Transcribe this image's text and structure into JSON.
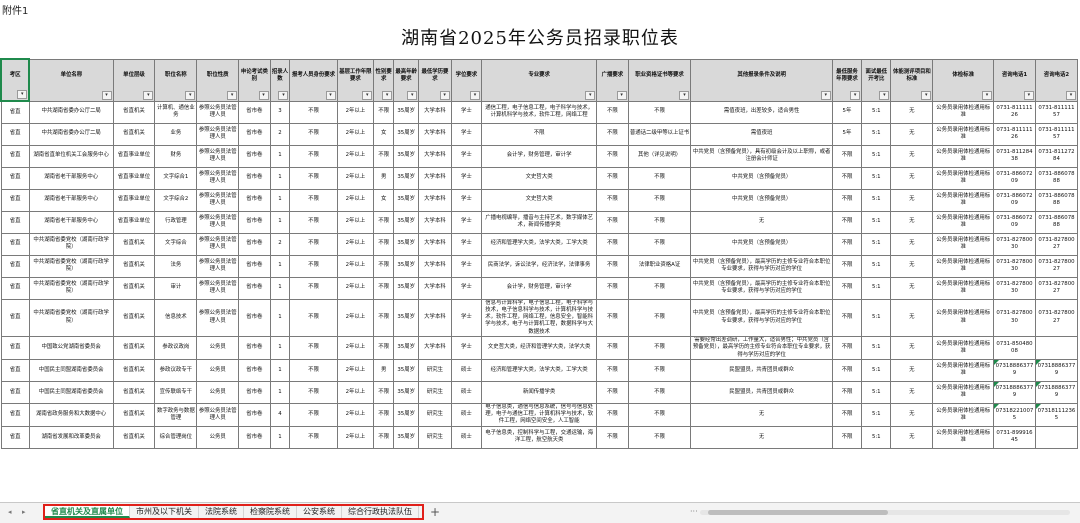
{
  "attachment_label": "附件1",
  "title": "湖南省2025年公务员招录职位表",
  "filter_icon": "▾",
  "headers": [
    "考区",
    "单位名称",
    "单位层级",
    "职位名称",
    "职位性质",
    "申论考试类别",
    "招录人数",
    "报考人员身份要求",
    "基层工作年限要求",
    "性别要求",
    "最高年龄要求",
    "最低学历要求",
    "学位要求",
    "专业要求",
    "广播要求",
    "职业资格证书等要求",
    "其他报录条件及说明",
    "最低服务年限要求",
    "面试最低开考比",
    "体能测评项目和标准",
    "体检标准",
    "咨询电话1",
    "咨询电话2"
  ],
  "rows": [
    [
      "省直",
      "中共湖南省委办公厅二局",
      "省直机关",
      "计算机、通信业务",
      "参照公务员法管理人员",
      "省市卷",
      "3",
      "不限",
      "2年以上",
      "不限",
      "35周岁",
      "大学本科",
      "学士",
      "通信工程，电子信息工程，电子科学与技术，计算机科学与技术，软件工程，网络工程",
      "不限",
      "不限",
      "需值夜班，出差较多，适合男性",
      "5年",
      "5:1",
      "无",
      "公务员录用体检通用标准",
      "0731-81111126",
      "0731-81111157"
    ],
    [
      "省直",
      "中共湖南省委办公厅二局",
      "省直机关",
      "业务",
      "参照公务员法管理人员",
      "省市卷",
      "2",
      "不限",
      "2年以上",
      "女",
      "35周岁",
      "大学本科",
      "学士",
      "不限",
      "不限",
      "普通话二级甲等以上证书",
      "需值夜班",
      "5年",
      "5:1",
      "无",
      "公务员录用体检通用标准",
      "0731-81111126",
      "0731-81111157"
    ],
    [
      "省直",
      "湖南省直单位机关工会服务中心",
      "省直事业单位",
      "财务",
      "参照公务员法管理人员",
      "省市卷",
      "1",
      "不限",
      "2年以上",
      "不限",
      "35周岁",
      "大学本科",
      "学士",
      "会计学，财务管理，审计学",
      "不限",
      "其他（详见说明）",
      "中共党员（含预备党员），具有初级会计及以上职称，或者注册会计师证",
      "不限",
      "5:1",
      "无",
      "公务员录用体检通用标准",
      "0731-81128438",
      "0731-81127284"
    ],
    [
      "省直",
      "湖南省老干部服务中心",
      "省直事业单位",
      "文字综合1",
      "参照公务员法管理人员",
      "省市卷",
      "1",
      "不限",
      "2年以上",
      "男",
      "35周岁",
      "大学本科",
      "学士",
      "文史哲大类",
      "不限",
      "不限",
      "中共党员（含预备党员）",
      "不限",
      "5:1",
      "无",
      "公务员录用体检通用标准",
      "0731-88607209",
      "0731-88607888"
    ],
    [
      "省直",
      "湖南省老干部服务中心",
      "省直事业单位",
      "文字综合2",
      "参照公务员法管理人员",
      "省市卷",
      "1",
      "不限",
      "2年以上",
      "女",
      "35周岁",
      "大学本科",
      "学士",
      "文史哲大类",
      "不限",
      "不限",
      "中共党员（含预备党员）",
      "不限",
      "5:1",
      "无",
      "公务员录用体检通用标准",
      "0731-88607209",
      "0731-88607888"
    ],
    [
      "省直",
      "湖南省老干部服务中心",
      "省直事业单位",
      "行政管理",
      "参照公务员法管理人员",
      "省市卷",
      "1",
      "不限",
      "2年以上",
      "不限",
      "35周岁",
      "大学本科",
      "学士",
      "广播电视编导，播音与主持艺术，数字媒体艺术，新闻传播学类",
      "不限",
      "不限",
      "无",
      "不限",
      "5:1",
      "无",
      "公务员录用体检通用标准",
      "0731-88607209",
      "0731-88607888"
    ],
    [
      "省直",
      "中共湖南省委党校（湖南行政学院）",
      "省直机关",
      "文字综合",
      "参照公务员法管理人员",
      "省市卷",
      "2",
      "不限",
      "2年以上",
      "不限",
      "35周岁",
      "大学本科",
      "学士",
      "经济和管理学大类，法学大类，工学大类",
      "不限",
      "不限",
      "中共党员（含预备党员）",
      "不限",
      "5:1",
      "无",
      "公务员录用体检通用标准",
      "0731-82780030",
      "0731-82780027"
    ],
    [
      "省直",
      "中共湖南省委党校（湖南行政学院）",
      "省直机关",
      "法务",
      "参照公务员法管理人员",
      "省市卷",
      "1",
      "不限",
      "2年以上",
      "不限",
      "35周岁",
      "大学本科",
      "学士",
      "民商法学，诉讼法学，经济法学，法律事务",
      "不限",
      "法律职业资格A证",
      "中共党员（含预备党员），最高学历的主修专业符合本职位专业要求，获得与学历对应的学位",
      "不限",
      "5:1",
      "无",
      "公务员录用体检通用标准",
      "0731-82780030",
      "0731-82780027"
    ],
    [
      "省直",
      "中共湖南省委党校（湖南行政学院）",
      "省直机关",
      "审计",
      "参照公务员法管理人员",
      "省市卷",
      "1",
      "不限",
      "2年以上",
      "不限",
      "35周岁",
      "大学本科",
      "学士",
      "会计学，财务管理，审计学",
      "不限",
      "不限",
      "中共党员（含预备党员），最高学历的主修专业符合本职位专业要求，获得与学历对应的学位",
      "不限",
      "5:1",
      "无",
      "公务员录用体检通用标准",
      "0731-82780030",
      "0731-82780027"
    ],
    [
      "省直",
      "中共湖南省委党校（湖南行政学院）",
      "省直机关",
      "信息技术",
      "参照公务员法管理人员",
      "省市卷",
      "1",
      "不限",
      "2年以上",
      "不限",
      "35周岁",
      "大学本科",
      "学士",
      "信息与计算科学，电子信息工程，电子科学与技术，电子信息科学与技术，计算机科学与技术，软件工程，网络工程，信息安全，智能科学与技术，电子与计算机工程，数据科学与大数据技术",
      "不限",
      "不限",
      "中共党员（含预备党员），最高学历的主修专业符合本职位专业要求，获得与学历对应的学位",
      "不限",
      "5:1",
      "无",
      "公务员录用体检通用标准",
      "0731-82780030",
      "0731-82780027"
    ],
    [
      "省直",
      "中国致公党湖南省委员会",
      "省直机关",
      "参政议政岗",
      "公务员",
      "省市卷",
      "1",
      "不限",
      "2年以上",
      "不限",
      "35周岁",
      "大学本科",
      "学士",
      "文史哲大类，经济和管理学大类，法学大类",
      "不限",
      "不限",
      "需要经常出差调研，工作量大，适合男性；中共党员（含预备党员），最高学历的主修专业符合本职位专业要求，获得与学历对应的学位",
      "不限",
      "5:1",
      "无",
      "公务员录用体检通用标准",
      "0731-85048008",
      ""
    ],
    [
      "省直",
      "中国民主同盟湖南省委员会",
      "省直机关",
      "参政议政专干",
      "公务员",
      "省市卷",
      "1",
      "不限",
      "2年以上",
      "男",
      "35周岁",
      "研究生",
      "硕士",
      "经济和管理学大类，法学大类，工学大类",
      "不限",
      "不限",
      "民盟盟员，共青团员或群众",
      "不限",
      "5:1",
      "无",
      "公务员录用体检通用标准",
      "07318886377 9",
      "073188863779"
    ],
    [
      "省直",
      "中国民主同盟湖南省委员会",
      "省直机关",
      "宣传联络专干",
      "公务员",
      "省市卷",
      "1",
      "不限",
      "2年以上",
      "不限",
      "35周岁",
      "研究生",
      "硕士",
      "新闻传播学类",
      "不限",
      "不限",
      "民盟盟员，共青团员或群众",
      "不限",
      "5:1",
      "无",
      "公务员录用体检通用标准",
      "07318886377 9",
      "073188863779"
    ],
    [
      "省直",
      "湖南省政务服务和大数据中心",
      "省直机关",
      "数字政务与数据管理",
      "参照公务员法管理人员",
      "省市卷",
      "4",
      "不限",
      "2年以上",
      "不限",
      "35周岁",
      "研究生",
      "硕士",
      "电子信息类，通信与信息系统，信号与信息处理，电子与通信工程，计算机科学与技术，软件工程，网络空间安全，人工智能",
      "不限",
      "不限",
      "无",
      "不限",
      "5:1",
      "无",
      "公务员录用体检通用标准",
      "07318221007 5",
      "073181112365"
    ],
    [
      "省直",
      "湖南省发展和改革委员会",
      "省直机关",
      "综合管理岗位",
      "公务员",
      "省市卷",
      "1",
      "不限",
      "2年以上",
      "不限",
      "35周岁",
      "研究生",
      "硕士",
      "电子信息类，控制科学与工程，交通运输，海洋工程，航空航天类",
      "不限",
      "不限",
      "无",
      "不限",
      "5:1",
      "无",
      "公务员录用体检通用标准",
      "0731-89991645",
      ""
    ]
  ],
  "sheet_tabs": [
    "省直机关及直属单位",
    "市州及以下机关",
    "法院系统",
    "检察院系统",
    "公安系统",
    "综合行政执法队伍"
  ],
  "active_tab_index": 0,
  "add_sheet_label": "+",
  "more_tabs_label": "···",
  "nav_prev_label": "◂",
  "nav_next_label": "▸",
  "colors": {
    "header_bg": "#d9d9d9",
    "accent_green": "#1f8a4c",
    "highlight_red": "#e0201a",
    "grid_line": "#7a7a7a"
  }
}
